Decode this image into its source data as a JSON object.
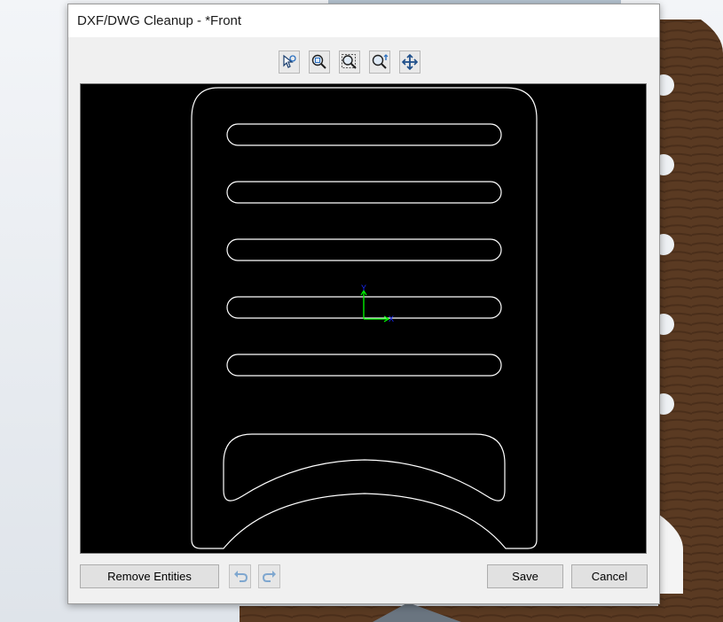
{
  "window": {
    "title": "DXF/DWG Cleanup - *Front"
  },
  "toolbar": {
    "tools": [
      {
        "icon": "select-tool-icon"
      },
      {
        "icon": "zoom-to-fit-icon"
      },
      {
        "icon": "zoom-to-area-icon"
      },
      {
        "icon": "zoom-in-out-icon"
      },
      {
        "icon": "pan-icon"
      }
    ]
  },
  "viewport": {
    "background": "#000000",
    "geometry_color": "#ffffff",
    "axis": {
      "x_label": "X",
      "y_label": "Y",
      "x_color": "#00ff00",
      "y_color": "#00ff00",
      "label_color": "#0000ff"
    }
  },
  "actions": {
    "remove_entities": "Remove Entities",
    "undo_icon": "undo-icon",
    "redo_icon": "redo-icon",
    "save": "Save",
    "cancel": "Cancel"
  },
  "colors": {
    "wood": "#5a3a22",
    "dialog_bg": "#f0f0f0",
    "history_icon": "#7fa7cf"
  }
}
